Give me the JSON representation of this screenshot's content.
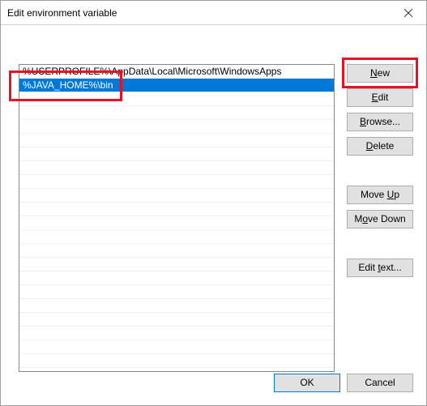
{
  "window": {
    "title": "Edit environment variable"
  },
  "list": {
    "items": [
      {
        "text": "%USERPROFILE%\\AppData\\Local\\Microsoft\\WindowsApps",
        "selected": false
      },
      {
        "text": "%JAVA_HOME%\\bin",
        "selected": true
      }
    ]
  },
  "buttons": {
    "new": "New",
    "edit": "Edit",
    "browse": "Browse...",
    "delete": "Delete",
    "moveup": "Move Up",
    "movedown": "Move Down",
    "edittext": "Edit text...",
    "ok": "OK",
    "cancel": "Cancel"
  }
}
